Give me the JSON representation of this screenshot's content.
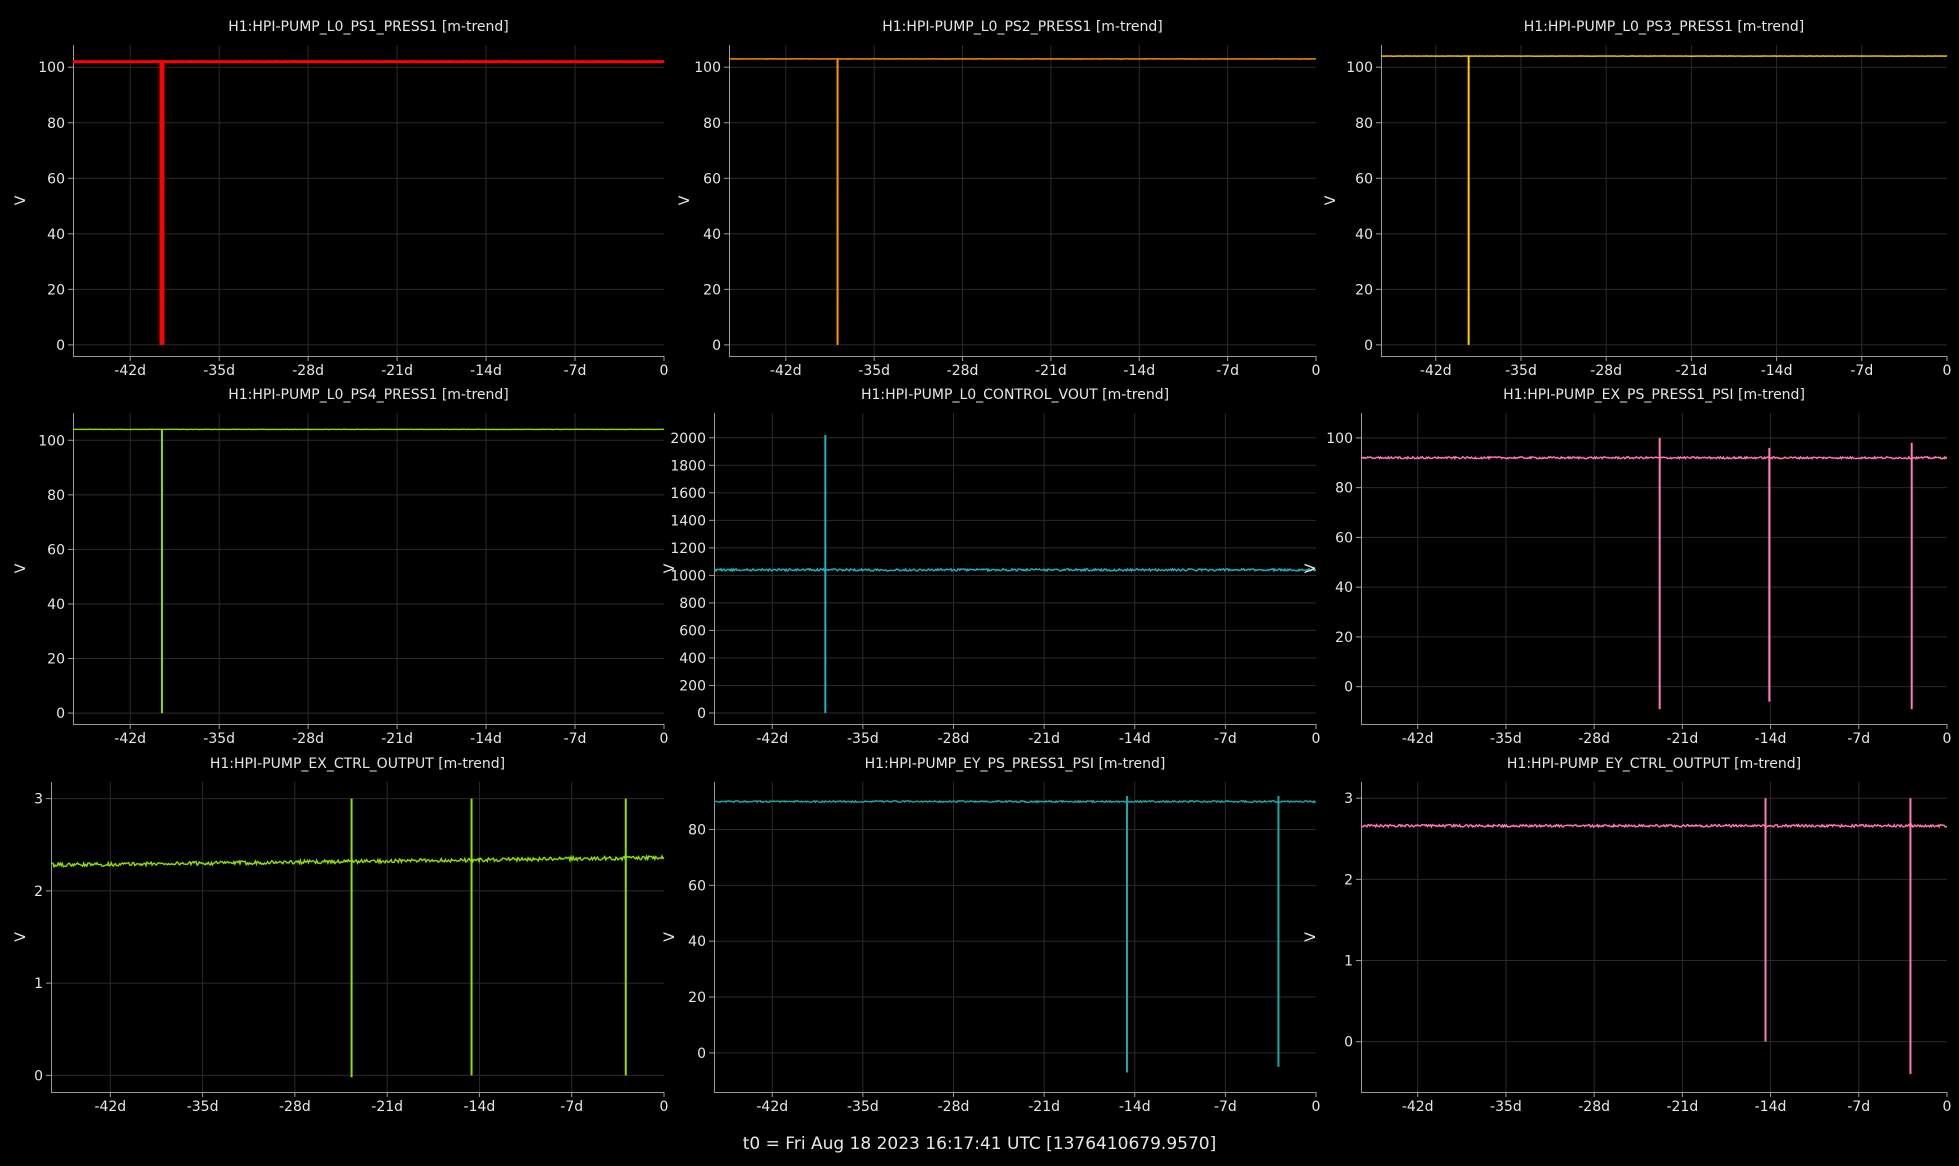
{
  "footer": "t0 = Fri Aug 18 2023 16:17:41 UTC [1376410679.9570]",
  "chart_data": [
    {
      "type": "line",
      "title": "H1:HPI-PUMP_L0_PS1_PRESS1 [m-trend]",
      "ylabel": "V",
      "color": "#ff0000",
      "xlim": [
        -46.5,
        0
      ],
      "ylim": [
        -4,
        108
      ],
      "xticks": [
        -42,
        -35,
        -28,
        -21,
        -14,
        -7,
        0
      ],
      "xticklabels": [
        "-42d",
        "-35d",
        "-28d",
        "-21d",
        "-14d",
        "-7d",
        "0"
      ],
      "yticks": [
        0,
        20,
        40,
        60,
        80,
        100
      ],
      "baseline": 102,
      "noise": 0.05,
      "series": [
        {
          "values": [
            102
          ]
        }
      ],
      "spikes": [
        {
          "x": -39.5,
          "min": 0,
          "max": 102
        }
      ]
    },
    {
      "type": "line",
      "title": "H1:HPI-PUMP_L0_PS2_PRESS1 [m-trend]",
      "ylabel": "V",
      "color": "#ff9500",
      "xlim": [
        -46.5,
        0
      ],
      "ylim": [
        -4,
        108
      ],
      "xticks": [
        -42,
        -35,
        -28,
        -21,
        -14,
        -7,
        0
      ],
      "xticklabels": [
        "-42d",
        "-35d",
        "-28d",
        "-21d",
        "-14d",
        "-7d",
        "0"
      ],
      "yticks": [
        0,
        20,
        40,
        60,
        80,
        100
      ],
      "baseline": 103,
      "noise": 0.05,
      "series": [
        {
          "values": [
            103
          ]
        }
      ],
      "spikes": [
        {
          "x": -37.9,
          "min": 0,
          "max": 103
        }
      ]
    },
    {
      "type": "line",
      "title": "H1:HPI-PUMP_L0_PS3_PRESS1 [m-trend]",
      "ylabel": "V",
      "color": "#ffcc00",
      "xlim": [
        -46.5,
        0
      ],
      "ylim": [
        -4,
        108
      ],
      "xticks": [
        -42,
        -35,
        -28,
        -21,
        -14,
        -7,
        0
      ],
      "xticklabels": [
        "-42d",
        "-35d",
        "-28d",
        "-21d",
        "-14d",
        "-7d",
        "0"
      ],
      "yticks": [
        0,
        20,
        40,
        60,
        80,
        100
      ],
      "baseline": 104,
      "noise": 0.05,
      "series": [
        {
          "values": [
            104
          ]
        }
      ],
      "spikes": [
        {
          "x": -39.3,
          "min": 0,
          "max": 104
        }
      ]
    },
    {
      "type": "line",
      "title": "H1:HPI-PUMP_L0_PS4_PRESS1 [m-trend]",
      "ylabel": "V",
      "color": "#8edb00",
      "xlim": [
        -46.5,
        0
      ],
      "ylim": [
        -4,
        110
      ],
      "xticks": [
        -42,
        -35,
        -28,
        -21,
        -14,
        -7,
        0
      ],
      "xticklabels": [
        "-42d",
        "-35d",
        "-28d",
        "-21d",
        "-14d",
        "-7d",
        "0"
      ],
      "yticks": [
        0,
        20,
        40,
        60,
        80,
        100
      ],
      "baseline": 104,
      "noise": 0.05,
      "series": [
        {
          "values": [
            104
          ]
        }
      ],
      "spikes": [
        {
          "x": -39.5,
          "min": 0,
          "max": 104
        }
      ]
    },
    {
      "type": "line",
      "title": "H1:HPI-PUMP_L0_CONTROL_VOUT [m-trend]",
      "ylabel": "V",
      "color": "#1fb4c4",
      "xlim": [
        -46.5,
        0
      ],
      "ylim": [
        -80,
        2180
      ],
      "xticks": [
        -42,
        -35,
        -28,
        -21,
        -14,
        -7,
        0
      ],
      "xticklabels": [
        "-42d",
        "-35d",
        "-28d",
        "-21d",
        "-14d",
        "-7d",
        "0"
      ],
      "yticks": [
        0,
        200,
        400,
        600,
        800,
        1000,
        1200,
        1400,
        1600,
        1800,
        2000
      ],
      "baseline": 1040,
      "noise": 8,
      "series": [
        {
          "values": [
            1040
          ]
        }
      ],
      "spikes": [
        {
          "x": -37.9,
          "min": 0,
          "max": 2020
        }
      ]
    },
    {
      "type": "line",
      "title": "H1:HPI-PUMP_EX_PS_PRESS1_PSI [m-trend]",
      "ylabel": "V",
      "color": "#ff7ab6",
      "xlim": [
        -46.5,
        0
      ],
      "ylim": [
        -15,
        110
      ],
      "xticks": [
        -42,
        -35,
        -28,
        -21,
        -14,
        -7,
        0
      ],
      "xticklabels": [
        "-42d",
        "-35d",
        "-28d",
        "-21d",
        "-14d",
        "-7d",
        "0"
      ],
      "yticks": [
        0,
        20,
        40,
        60,
        80,
        100
      ],
      "baseline": 92,
      "noise": 0.4,
      "series": [
        {
          "values": [
            92
          ]
        }
      ],
      "spikes": [
        {
          "x": -22.8,
          "min": -9,
          "max": 100
        },
        {
          "x": -14.1,
          "min": -6,
          "max": 96
        },
        {
          "x": -2.8,
          "min": -9,
          "max": 98
        }
      ]
    },
    {
      "type": "line",
      "title": "H1:HPI-PUMP_EX_CTRL_OUTPUT [m-trend]",
      "ylabel": "V",
      "color": "#8fe000",
      "xlim": [
        -46.5,
        0
      ],
      "ylim": [
        -0.18,
        3.18
      ],
      "xticks": [
        -42,
        -35,
        -28,
        -21,
        -14,
        -7,
        0
      ],
      "xticklabels": [
        "-42d",
        "-35d",
        "-28d",
        "-21d",
        "-14d",
        "-7d",
        "0"
      ],
      "yticks": [
        0,
        1,
        2,
        3
      ],
      "baseline": 2.3,
      "noise": 0.02,
      "series": [
        {
          "values": [
            2.28,
            2.36
          ]
        }
      ],
      "spikes": [
        {
          "x": -23.7,
          "min": -0.02,
          "max": 3.0
        },
        {
          "x": -14.6,
          "min": 0.0,
          "max": 3.0
        },
        {
          "x": -2.9,
          "min": 0.0,
          "max": 3.0
        }
      ]
    },
    {
      "type": "line",
      "title": "H1:HPI-PUMP_EY_PS_PRESS1_PSI [m-trend]",
      "ylabel": "V",
      "color": "#1aa9a5",
      "xlim": [
        -46.5,
        0
      ],
      "ylim": [
        -14,
        97
      ],
      "xticks": [
        -42,
        -35,
        -28,
        -21,
        -14,
        -7,
        0
      ],
      "xticklabels": [
        "-42d",
        "-35d",
        "-28d",
        "-21d",
        "-14d",
        "-7d",
        "0"
      ],
      "yticks": [
        0,
        20,
        40,
        60,
        80
      ],
      "baseline": 90,
      "noise": 0.3,
      "series": [
        {
          "values": [
            90
          ]
        }
      ],
      "spikes": [
        {
          "x": -14.6,
          "min": -7,
          "max": 92
        },
        {
          "x": -2.9,
          "min": -5,
          "max": 92
        }
      ]
    },
    {
      "type": "line",
      "title": "H1:HPI-PUMP_EY_CTRL_OUTPUT [m-trend]",
      "ylabel": "V",
      "color": "#ff7ab6",
      "xlim": [
        -46.5,
        0
      ],
      "ylim": [
        -0.62,
        3.2
      ],
      "xticks": [
        -42,
        -35,
        -28,
        -21,
        -14,
        -7,
        0
      ],
      "xticklabels": [
        "-42d",
        "-35d",
        "-28d",
        "-21d",
        "-14d",
        "-7d",
        "0"
      ],
      "yticks": [
        0,
        1,
        2,
        3
      ],
      "baseline": 2.66,
      "noise": 0.015,
      "series": [
        {
          "values": [
            2.66
          ]
        }
      ],
      "spikes": [
        {
          "x": -14.4,
          "min": 0.0,
          "max": 3.0
        },
        {
          "x": -2.9,
          "min": -0.4,
          "max": 3.0
        }
      ]
    }
  ]
}
